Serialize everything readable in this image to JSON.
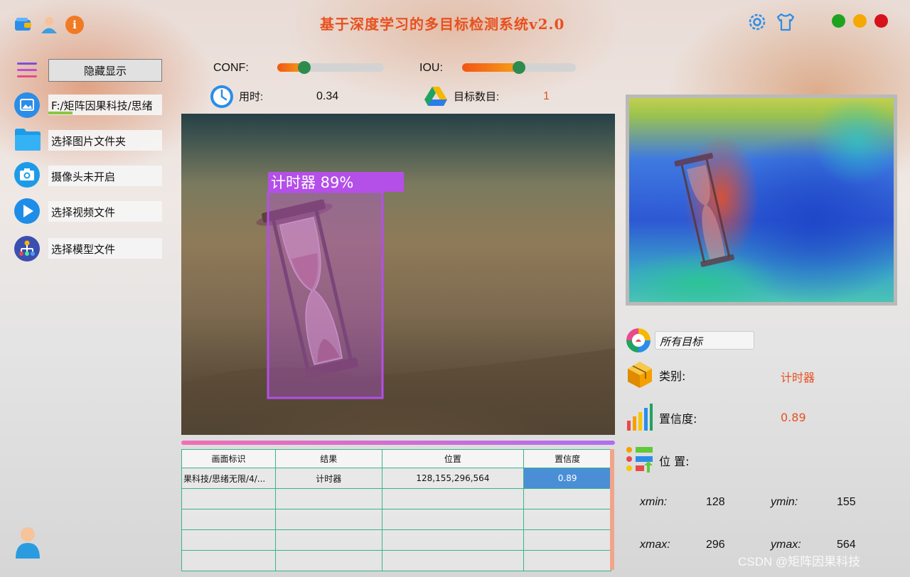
{
  "app": {
    "title": "基于深度学习的多目标检测系统v2.0",
    "accent_color": "#e8501e"
  },
  "top_icons": [
    "wallet-icon",
    "user-icon",
    "info-icon",
    "settings-icon",
    "shirt-icon"
  ],
  "window_buttons": [
    {
      "name": "maximize",
      "color": "#1fa31f"
    },
    {
      "name": "minimize",
      "color": "#f5a800"
    },
    {
      "name": "close",
      "color": "#d6121c"
    }
  ],
  "sidebar": {
    "toggle_label": "隐藏显示",
    "items": [
      {
        "icon": "image-icon",
        "label": "F:/矩阵因果科技/思绪"
      },
      {
        "icon": "folder-icon",
        "label": "选择图片文件夹"
      },
      {
        "icon": "camera-icon",
        "label": "摄像头未开启"
      },
      {
        "icon": "play-icon",
        "label": "选择视频文件"
      },
      {
        "icon": "model-icon",
        "label": "选择模型文件"
      }
    ]
  },
  "controls": {
    "conf_label": "CONF:",
    "conf_value": 0.25,
    "iou_label": "IOU:",
    "iou_value": 0.5,
    "time_label": "用时:",
    "time_value": "0.34",
    "count_label": "目标数目:",
    "count_value": "1"
  },
  "detection": {
    "box_label": "计时器  89%",
    "box_color": "#b44fe8"
  },
  "table": {
    "headers": [
      "画面标识",
      "结果",
      "位置",
      "置信度"
    ],
    "rows": [
      [
        "果科技/思绪无限/4/...",
        "计时器",
        "128,155,296,564",
        "0.89"
      ]
    ]
  },
  "result": {
    "target_select": "所有目标",
    "class_label": "类别:",
    "class_value": "计时器",
    "conf_label": "置信度:",
    "conf_value": "0.89",
    "pos_label": "位 置:",
    "xmin_label": "xmin:",
    "xmin": "128",
    "ymin_label": "ymin:",
    "ymin": "155",
    "xmax_label": "xmax:",
    "xmax": "296",
    "ymax_label": "ymax:",
    "ymax": "564"
  },
  "watermark": "CSDN @矩阵因果科技"
}
